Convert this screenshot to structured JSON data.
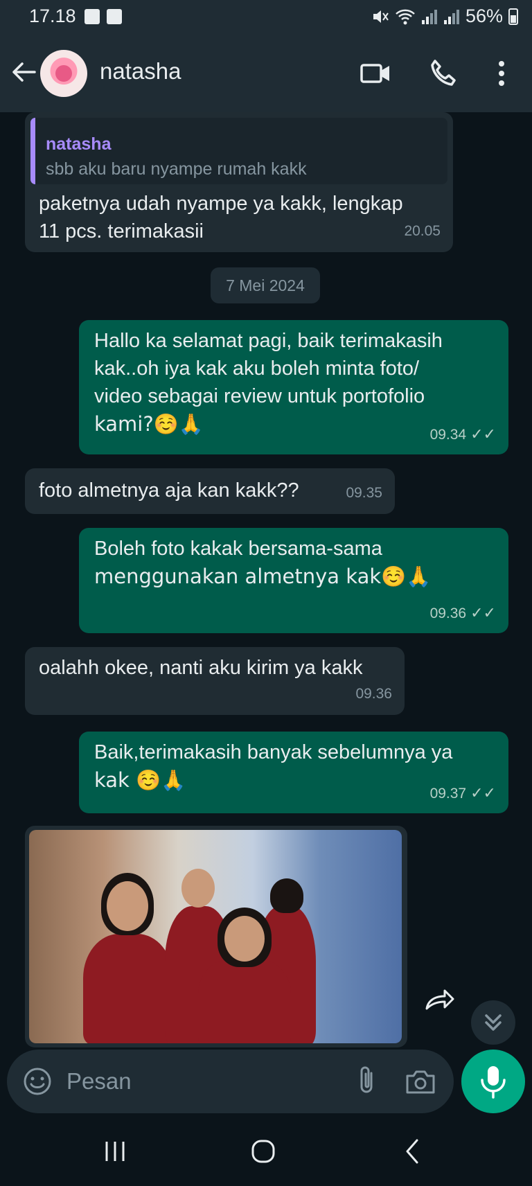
{
  "status_bar": {
    "time": "17.18",
    "battery": "56%"
  },
  "header": {
    "contact_name": "natasha",
    "icons": [
      "back-arrow-icon",
      "video-call-icon",
      "phone-icon",
      "more-vert-icon"
    ]
  },
  "messages": [
    {
      "direction": "in",
      "quote": {
        "name": "natasha",
        "text": "sbb aku baru nyampe rumah kakk"
      },
      "lines": [
        "paketnya udah nyampe ya kakk, lengkap",
        "11 pcs. terimakasii"
      ],
      "time": "20.05"
    },
    {
      "direction": "out",
      "lines": [
        "Hallo ka selamat pagi, baik terimakasih",
        "kak..oh iya kak aku boleh minta foto/",
        "video sebagai review untuk portofolio",
        "kami?☺️🙏"
      ],
      "time": "09.34"
    },
    {
      "direction": "in",
      "lines": [
        "foto almetnya aja kan kakk??"
      ],
      "time": "09.35"
    },
    {
      "direction": "out",
      "lines": [
        "Boleh foto kakak bersama-sama",
        "menggunakan almetnya kak☺️🙏"
      ],
      "time": "09.36"
    },
    {
      "direction": "in",
      "lines": [
        "oalahh okee, nanti aku kirim ya kakk"
      ],
      "time": "09.36"
    },
    {
      "direction": "out",
      "lines": [
        "Baik,terimakasih banyak sebelumnya ya",
        "kak ☺️🙏"
      ],
      "time": "09.37"
    }
  ],
  "date_separator": "7 Mei 2024",
  "read_ticks": "✓✓",
  "composer": {
    "placeholder": "Pesan"
  },
  "colors": {
    "background": "#0b141a",
    "incoming_bubble": "#202c33",
    "outgoing_bubble": "#005c4b",
    "accent": "#00a884",
    "quote_name": "#a78bfa"
  }
}
